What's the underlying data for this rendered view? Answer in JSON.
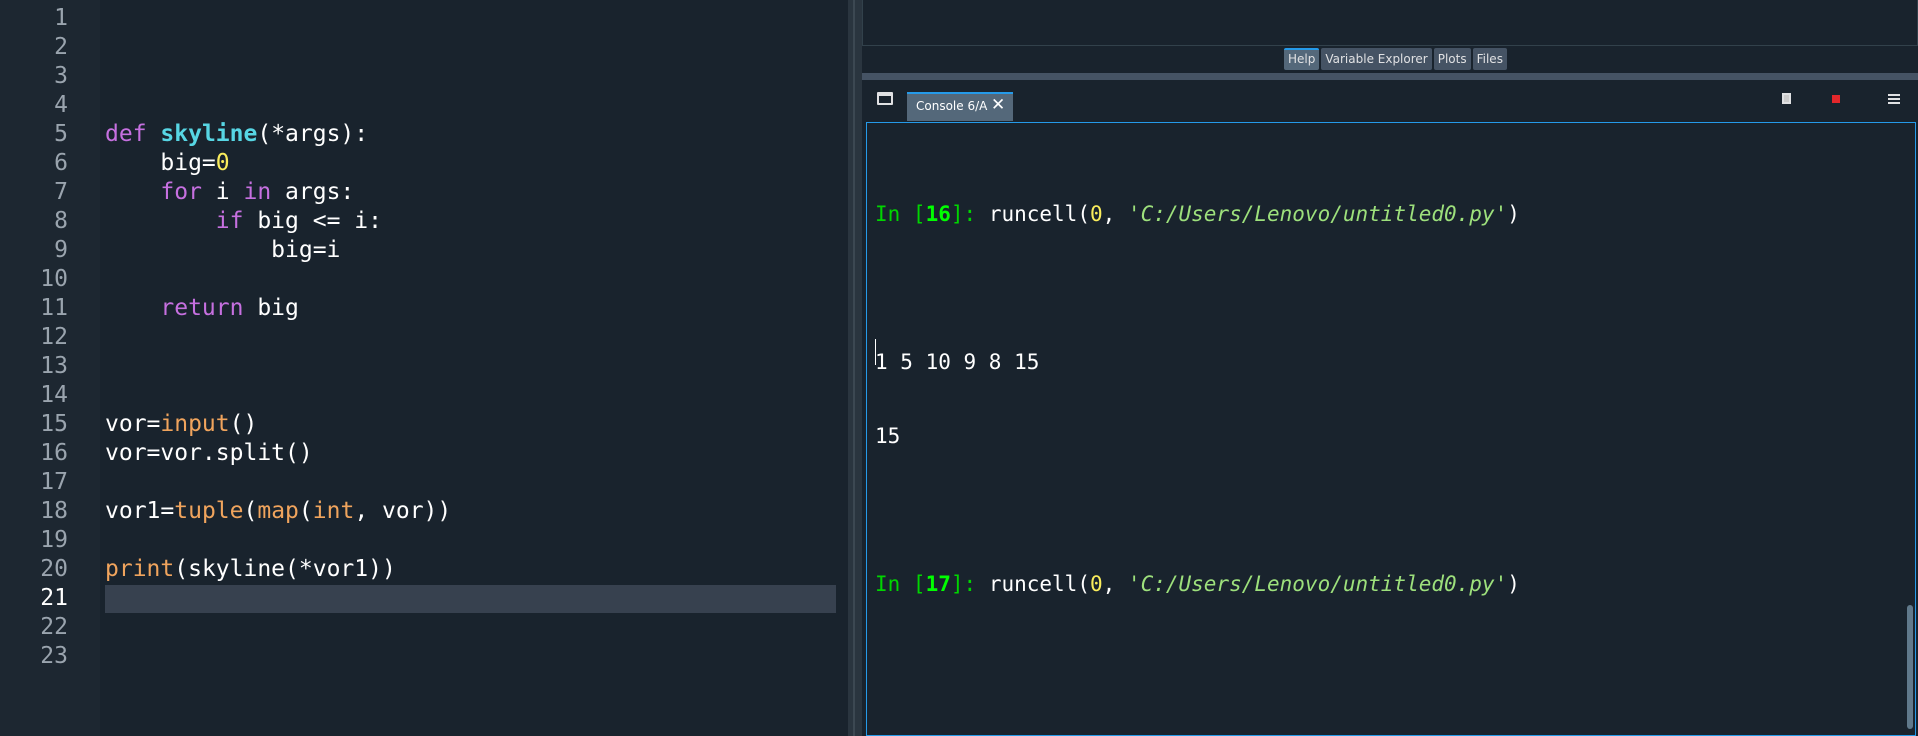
{
  "editor": {
    "line_numbers": [
      "1",
      "2",
      "3",
      "4",
      "5",
      "6",
      "7",
      "8",
      "9",
      "10",
      "11",
      "12",
      "13",
      "14",
      "15",
      "16",
      "17",
      "18",
      "19",
      "20",
      "21",
      "22",
      "23"
    ],
    "current_line": "21",
    "code": {
      "l5_def": "def",
      "l5_name": "skyline",
      "l5_rest": "(*args):",
      "l6_a": "    big=",
      "l6_num": "0",
      "l7_for": "for",
      "l7_a": " i ",
      "l7_in": "in",
      "l7_b": " args:",
      "l8_if": "if",
      "l8_rest": " big <= i:",
      "l9": "            big=i",
      "l11_return": "return",
      "l11_rest": " big",
      "l15_a": "vor=",
      "l15_input": "input",
      "l15_b": "()",
      "l16": "vor=vor.split()",
      "l18_a": "vor1=",
      "l18_tuple": "tuple",
      "l18_b": "(",
      "l18_map": "map",
      "l18_c": "(",
      "l18_int": "int",
      "l18_d": ", vor))",
      "l20_print": "print",
      "l20_rest": "(skyline(*vor1))"
    }
  },
  "pane_tabs": [
    "Help",
    "Variable Explorer",
    "Plots",
    "Files"
  ],
  "console_tab": {
    "label": "Console 6/A",
    "close": "✕"
  },
  "console": {
    "in1_prefix": "In [",
    "in1_num": "16",
    "in1_suffix": "]: ",
    "in1_cmd": "runcell(",
    "in1_arg0": "0",
    "in1_sep": ", ",
    "in1_path": "'C:/Users/Lenovo/untitled0.py'",
    "in1_end": ")",
    "out1": "1 5 10 9 8 15",
    "out2": "15",
    "in2_prefix": "In [",
    "in2_num": "17",
    "in2_suffix": "]: ",
    "in2_cmd": "runcell(",
    "in2_arg0": "0",
    "in2_sep": ", ",
    "in2_path": "'C:/Users/Lenovo/untitled0.py'",
    "in2_end": ")"
  }
}
